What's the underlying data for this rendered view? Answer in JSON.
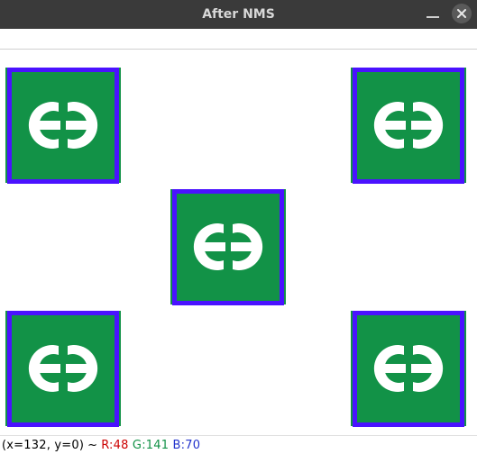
{
  "window": {
    "title": "After NMS"
  },
  "status": {
    "coord_prefix": "(x=",
    "x": "132",
    "coord_mid": ", y=",
    "y": "0",
    "coord_suffix": ")",
    "tilde": "~",
    "r_label": "R:",
    "r_val": "48",
    "g_label": "G:",
    "g_val": "141",
    "b_label": "B:",
    "b_val": "70"
  },
  "detections": [
    {
      "id": 1
    },
    {
      "id": 2
    },
    {
      "id": 3
    },
    {
      "id": 4
    },
    {
      "id": 5
    }
  ]
}
